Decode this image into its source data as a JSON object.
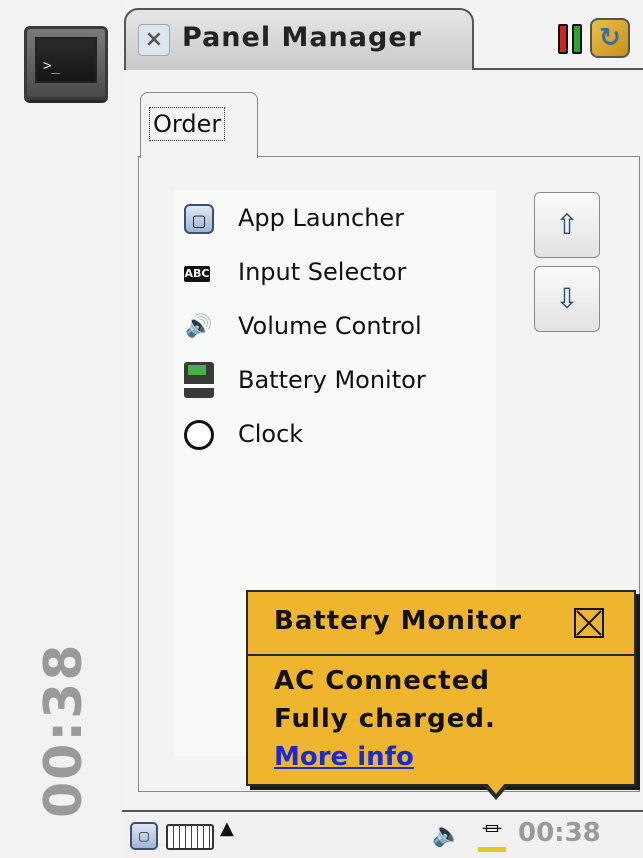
{
  "left_panel": {
    "terminal_glyph": ">_",
    "clock_vertical": "00:38"
  },
  "tab_bar": {
    "tab_title": "Panel Manager",
    "close_glyph": "×",
    "status_colors": {
      "red": "#d02626",
      "green": "#2ea52e"
    },
    "sync_icon_glyph": "↻"
  },
  "main": {
    "tab_label": "Order",
    "list_items": [
      {
        "label": "App Launcher",
        "icon": "app-launcher-icon",
        "glyph": "▢"
      },
      {
        "label": "Input Selector",
        "icon": "abc-keyboard-icon",
        "glyph": "ABC"
      },
      {
        "label": "Volume Control",
        "icon": "speaker-icon",
        "glyph": "🔊"
      },
      {
        "label": "Battery Monitor",
        "icon": "battery-icon",
        "glyph": ""
      },
      {
        "label": "Clock",
        "icon": "clock-icon",
        "glyph": "🕓"
      }
    ],
    "move_up_glyph": "⇧",
    "move_down_glyph": "⇩"
  },
  "popup": {
    "title": "Battery Monitor",
    "line1": "AC Connected",
    "line2": "Fully charged.",
    "link": "More info",
    "background": "#f0b52e",
    "link_color": "#1a2ccf"
  },
  "bottom_bar": {
    "launcher_glyph": "▢",
    "arrow_glyph": "▲",
    "volume_glyph": "🔈",
    "plug_glyph": "⏛",
    "clock": "00:38"
  }
}
